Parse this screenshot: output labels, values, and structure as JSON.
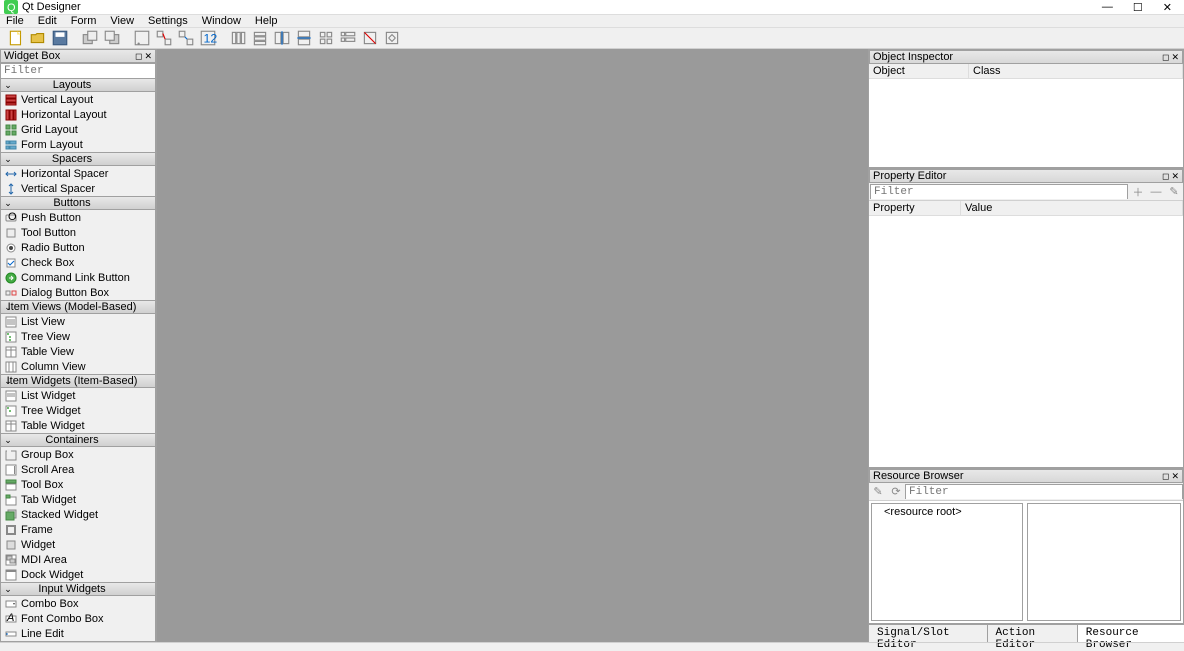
{
  "title": "Qt Designer",
  "menu": [
    "File",
    "Edit",
    "Form",
    "View",
    "Settings",
    "Window",
    "Help"
  ],
  "widgetbox": {
    "title": "Widget Box",
    "filter_placeholder": "Filter",
    "categories": [
      {
        "name": "Layouts",
        "items": [
          {
            "id": "vlayout",
            "label": "Vertical Layout"
          },
          {
            "id": "hlayout",
            "label": "Horizontal Layout"
          },
          {
            "id": "grid",
            "label": "Grid Layout"
          },
          {
            "id": "form",
            "label": "Form Layout"
          }
        ]
      },
      {
        "name": "Spacers",
        "items": [
          {
            "id": "hspacer",
            "label": "Horizontal Spacer"
          },
          {
            "id": "vspacer",
            "label": "Vertical Spacer"
          }
        ]
      },
      {
        "name": "Buttons",
        "items": [
          {
            "id": "push",
            "label": "Push Button"
          },
          {
            "id": "tool",
            "label": "Tool Button"
          },
          {
            "id": "radio",
            "label": "Radio Button"
          },
          {
            "id": "check",
            "label": "Check Box"
          },
          {
            "id": "cmdlink",
            "label": "Command Link Button"
          },
          {
            "id": "dlgbtn",
            "label": "Dialog Button Box"
          }
        ]
      },
      {
        "name": "Item Views (Model-Based)",
        "items": [
          {
            "id": "listv",
            "label": "List View"
          },
          {
            "id": "treev",
            "label": "Tree View"
          },
          {
            "id": "tablev",
            "label": "Table View"
          },
          {
            "id": "colv",
            "label": "Column View"
          }
        ]
      },
      {
        "name": "Item Widgets (Item-Based)",
        "items": [
          {
            "id": "listw",
            "label": "List Widget"
          },
          {
            "id": "treew",
            "label": "Tree Widget"
          },
          {
            "id": "tablew",
            "label": "Table Widget"
          }
        ]
      },
      {
        "name": "Containers",
        "items": [
          {
            "id": "groupbox",
            "label": "Group Box"
          },
          {
            "id": "scroll",
            "label": "Scroll Area"
          },
          {
            "id": "toolbox",
            "label": "Tool Box"
          },
          {
            "id": "tabw",
            "label": "Tab Widget"
          },
          {
            "id": "stacked",
            "label": "Stacked Widget"
          },
          {
            "id": "frame",
            "label": "Frame"
          },
          {
            "id": "widget",
            "label": "Widget"
          },
          {
            "id": "mdi",
            "label": "MDI Area"
          },
          {
            "id": "dock",
            "label": "Dock Widget"
          }
        ]
      },
      {
        "name": "Input Widgets",
        "items": [
          {
            "id": "combo",
            "label": "Combo Box"
          },
          {
            "id": "fontcombo",
            "label": "Font Combo Box"
          },
          {
            "id": "lineedit",
            "label": "Line Edit"
          }
        ]
      }
    ]
  },
  "objectinspector": {
    "title": "Object Inspector",
    "cols": [
      "Object",
      "Class"
    ]
  },
  "propertyeditor": {
    "title": "Property Editor",
    "filter_placeholder": "Filter",
    "cols": [
      "Property",
      "Value"
    ]
  },
  "resourcebrowser": {
    "title": "Resource Browser",
    "filter_placeholder": "Filter",
    "root": "<resource root>"
  },
  "tabs": [
    "Signal/Slot Editor",
    "Action Editor",
    "Resource Browser"
  ]
}
